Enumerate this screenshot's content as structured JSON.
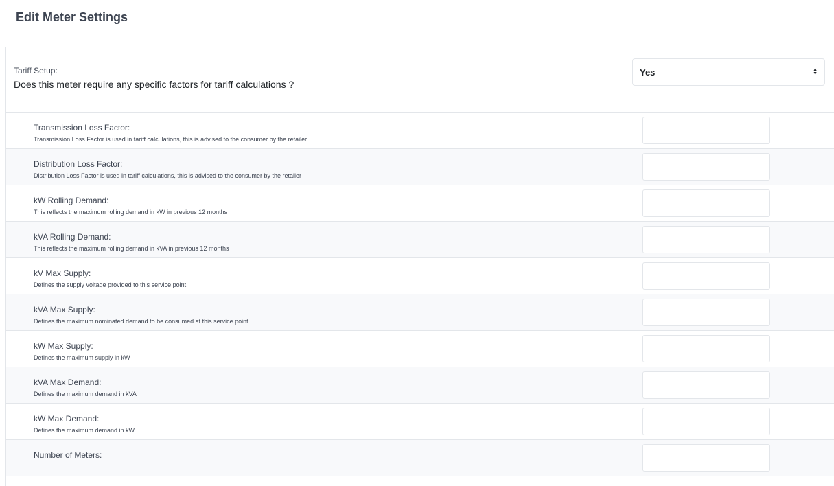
{
  "page": {
    "title": "Edit Meter Settings"
  },
  "tariff": {
    "label": "Tariff Setup:",
    "question": "Does this meter require any specific factors for tariff calculations ?",
    "selected": "Yes"
  },
  "fields": [
    {
      "label": "Transmission Loss Factor:",
      "help": "Transmission Loss Factor is used in tariff calculations, this is advised to the consumer by the retailer",
      "value": ""
    },
    {
      "label": "Distribution Loss Factor:",
      "help": "Distribution Loss Factor is used in tariff calculations, this is advised to the consumer by the retailer",
      "value": ""
    },
    {
      "label": "kW Rolling Demand:",
      "help": "This reflects the maximum rolling demand in kW in previous 12 months",
      "value": ""
    },
    {
      "label": "kVA Rolling Demand:",
      "help": "This reflects the maximum rolling demand in kVA in previous 12 months",
      "value": ""
    },
    {
      "label": "kV Max Supply:",
      "help": "Defines the supply voltage provided to this service point",
      "value": ""
    },
    {
      "label": "kVA Max Supply:",
      "help": "Defines the maximum nominated demand to be consumed at this service point",
      "value": ""
    },
    {
      "label": "kW Max Supply:",
      "help": "Defines the maximum supply in kW",
      "value": ""
    },
    {
      "label": "kVA Max Demand:",
      "help": "Defines the maximum demand in kVA",
      "value": ""
    },
    {
      "label": "kW Max Demand:",
      "help": "Defines the maximum demand in kW",
      "value": ""
    },
    {
      "label": "Number of Meters:",
      "help": "",
      "value": ""
    }
  ]
}
